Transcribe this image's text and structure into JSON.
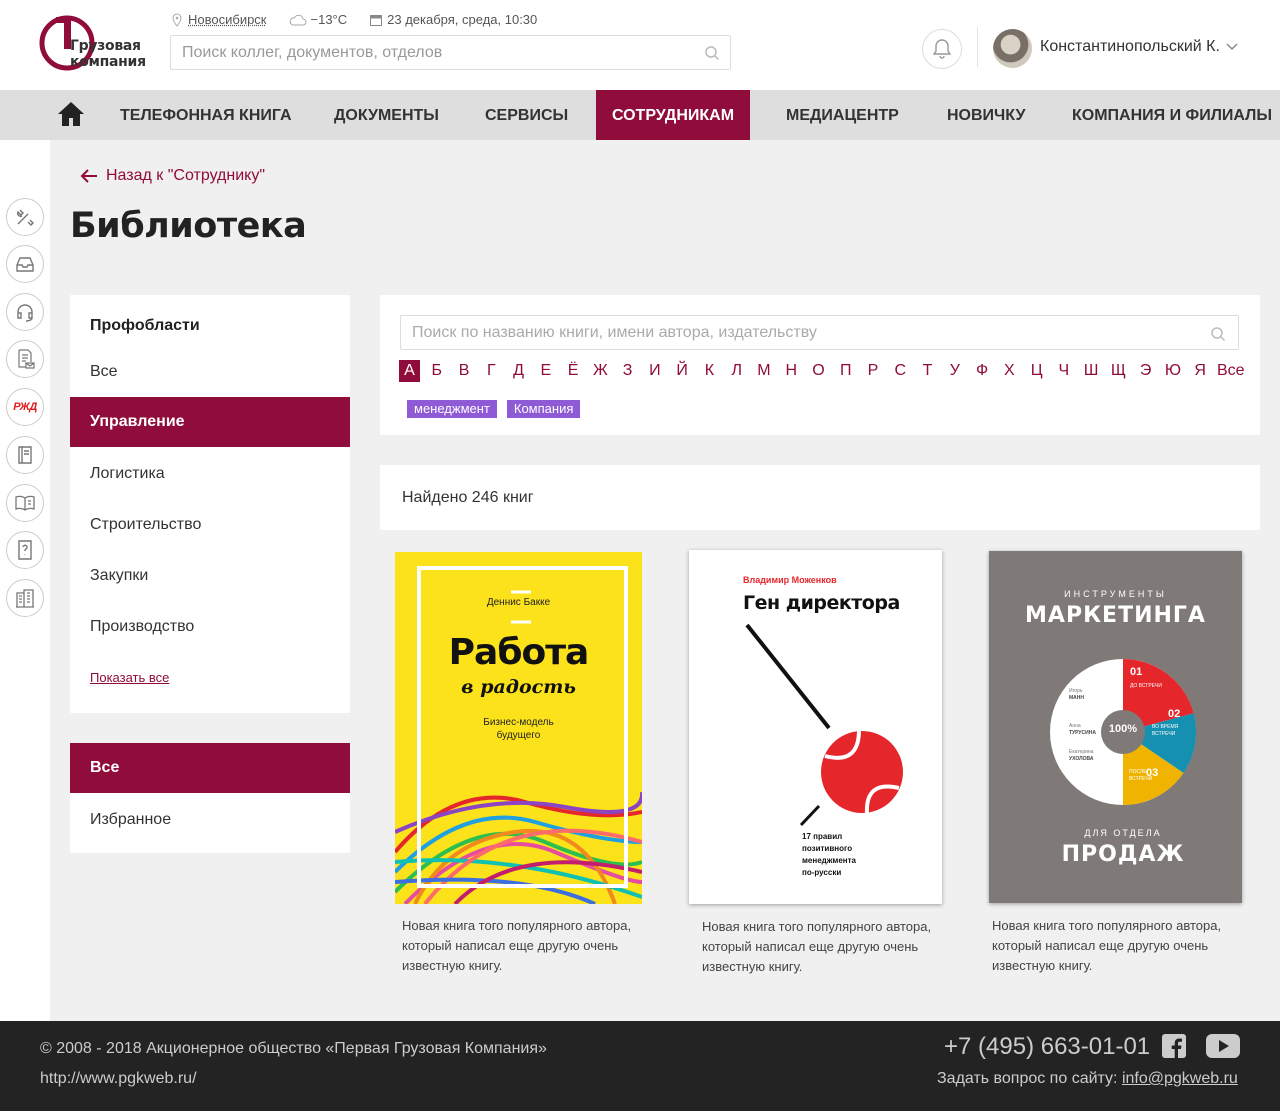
{
  "header": {
    "logo_line1": "Грузовая",
    "logo_line2": "компания",
    "city": "Новосибирск",
    "weather": "−13°С",
    "datetime": "23 декабря, среда, 10:30",
    "search_placeholder": "Поиск коллег, документов, отделов",
    "user_name": "Константинопольский К."
  },
  "nav": {
    "items": [
      {
        "label": "Телефонная книга"
      },
      {
        "label": "Документы"
      },
      {
        "label": "Сервисы"
      },
      {
        "label": "Сотрудникам",
        "active": true
      },
      {
        "label": "Медиацентр"
      },
      {
        "label": "Новичку"
      },
      {
        "label": "Компания и филиалы"
      }
    ]
  },
  "rail": {
    "icons": [
      "tools-icon",
      "inbox-icon",
      "headset-icon",
      "documents-mail-icon",
      "rzd-logo-icon",
      "book-icon",
      "open-book-icon",
      "question-document-icon",
      "building-icon"
    ],
    "rzd_text": "РЖД",
    "rzd_color": "#e21a1a"
  },
  "page": {
    "back_label": "Назад к \"Сотруднику\"",
    "title": "Библиотека"
  },
  "filters": {
    "heading": "Профобласти",
    "options": [
      "Все",
      "Управление",
      "Логистика",
      "Строительство",
      "Закупки",
      "Производство"
    ],
    "active_index": 1,
    "show_all": "Показать все"
  },
  "scope": {
    "options": [
      "Все",
      "Избранное"
    ],
    "active_index": 0
  },
  "library_search": {
    "placeholder": "Поиск по названию книги, имени автора, издательству",
    "letters": [
      "А",
      "Б",
      "В",
      "Г",
      "Д",
      "Е",
      "Ё",
      "Ж",
      "З",
      "И",
      "Й",
      "К",
      "Л",
      "М",
      "Н",
      "О",
      "П",
      "Р",
      "С",
      "Т",
      "У",
      "Ф",
      "Х",
      "Ц",
      "Ч",
      "Ш",
      "Щ",
      "Э",
      "Ю",
      "Я",
      "Все"
    ],
    "active_letter": "А",
    "tags": [
      "менеджмент",
      "Компания"
    ]
  },
  "results": {
    "found_text": "Найдено 246 книг"
  },
  "books": [
    {
      "author": "Деннис Бакке",
      "title_main": "Работа",
      "title_sub": "в радость",
      "subtitle": "Бизнес-модель будущего",
      "cover_color": "#fce21a",
      "description": "Новая книга того популярного автора, который написал еще другую очень известную книгу."
    },
    {
      "author": "Владимир Моженков",
      "title_main": "Ген директора",
      "subtitle_lines": [
        "17 правил",
        "позитивного",
        "менеджмента",
        "по-русски"
      ],
      "cover_color": "#ffffff",
      "accent": "#e5262b",
      "description": "Новая книга того популярного автора, который написал еще другую очень известную книгу."
    },
    {
      "overline": "ИНСТРУМЕНТЫ",
      "title_main": "МАРКЕТИНГА",
      "under": "ДЛЯ ОТДЕЛА",
      "title_bottom": "ПРОДАЖ",
      "center": "100%",
      "segments": [
        {
          "num": "01",
          "label": "ДО ВСТРЕЧИ",
          "color": "#e5262b"
        },
        {
          "num": "02",
          "label": "ВО ВРЕМЯ ВСТРЕЧИ",
          "color": "#1690b0"
        },
        {
          "num": "03",
          "label": "ПОСЛЕ ВСТРЕЧИ",
          "color": "#f0b400"
        }
      ],
      "authors": [
        {
          "first": "Игорь",
          "last": "МАНН"
        },
        {
          "first": "Анна",
          "last": "ТУРУСИНА"
        },
        {
          "first": "Екатерина",
          "last": "УХОЛОВА"
        }
      ],
      "cover_color": "#7f7a78",
      "description": "Новая книга того популярного автора, который написал еще другую очень известную книгу."
    }
  ],
  "footer": {
    "copyright": "© 2008 - 2018 Акционерное общество «Первая Грузовая Компания»",
    "url": "http://www.pgkweb.ru/",
    "phone": "+7 (495) 663-01-01",
    "ask_label": "Задать вопрос по сайту:",
    "email": "info@pgkweb.ru"
  },
  "colors": {
    "brand": "#900c3a",
    "tag": "#8f5ad6",
    "footer_bg": "#232323"
  }
}
